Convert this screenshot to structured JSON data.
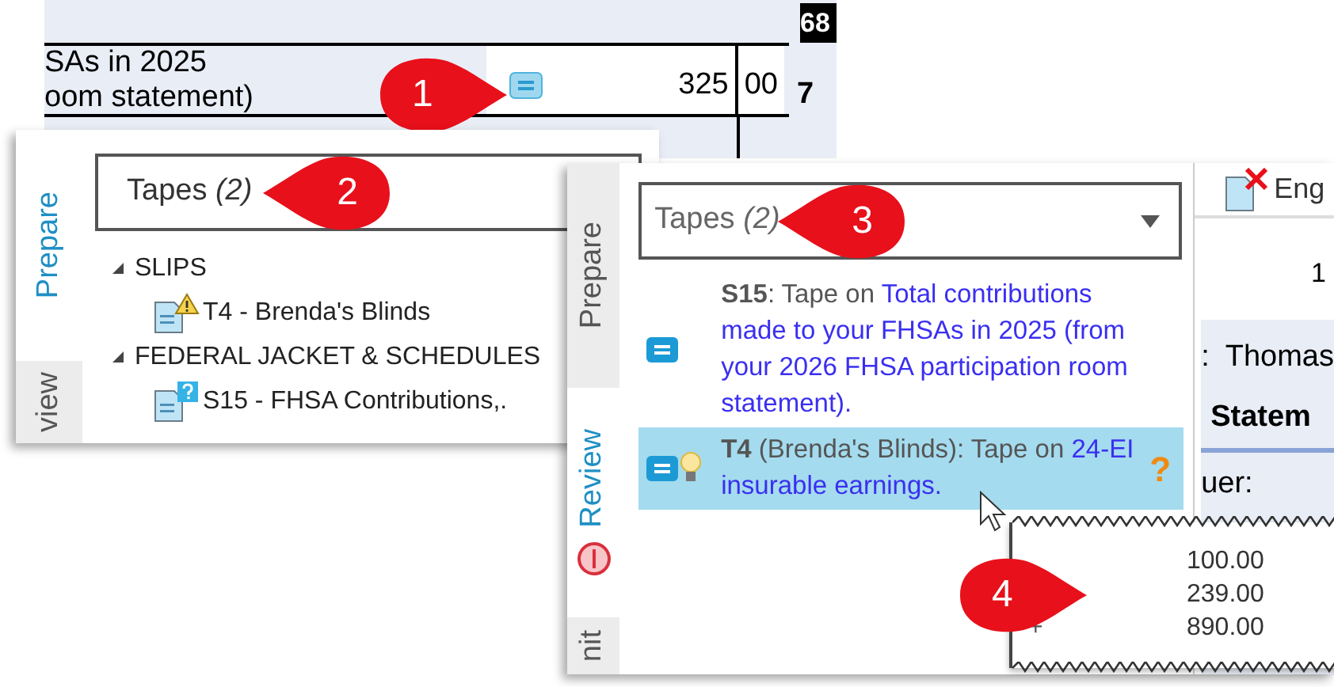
{
  "form_snippet": {
    "column_header": "68",
    "description_lines": [
      "SAs in 2025",
      "oom statement)"
    ],
    "amount_dollars": "325",
    "amount_cents": "00",
    "line_number": "7"
  },
  "left_panel": {
    "tabs": [
      {
        "label": "Prepare",
        "selected": true
      },
      {
        "label": "view",
        "selected": false
      }
    ],
    "dropdown": {
      "value": "Tapes",
      "count": "(2)"
    },
    "tree": [
      {
        "label": "SLIPS",
        "expanded": true,
        "children": [
          {
            "label": "T4 - Brenda's Blinds",
            "kind": "warning"
          }
        ]
      },
      {
        "label": "FEDERAL JACKET & SCHEDULES",
        "expanded": true,
        "children": [
          {
            "label": "S15 - FHSA Contributions,.",
            "kind": "question"
          }
        ]
      }
    ]
  },
  "right_panel": {
    "tabs": [
      {
        "label": "Prepare",
        "selected": false
      },
      {
        "label": "Review",
        "selected": true
      },
      {
        "label": "nit",
        "selected": false
      }
    ],
    "dropdown": {
      "value": "Tapes",
      "count": "(2)"
    },
    "tapes": [
      {
        "form": "S15",
        "note": ": Tape on ",
        "link": "Total contributions made to your FHSAs in 2025 (from your 2026 FHSA participation room statement).",
        "selected": false,
        "hint": false
      },
      {
        "form": "T4",
        "note": " (Brenda's Blinds): Tape on ",
        "link": "24-EI insurable earnings.",
        "selected": true,
        "hint": true,
        "query_mark": "?"
      }
    ]
  },
  "side_view": {
    "toolbar_label": "Eng",
    "page_number": "1",
    "label_fragment": ":",
    "name_value": "Thomas",
    "heading": "Statem",
    "field_label": "uer:"
  },
  "tape_popup": {
    "rows": [
      {
        "value": "100.00"
      },
      {
        "value": "239.00"
      },
      {
        "sign": "+",
        "value": "890.00"
      }
    ]
  },
  "callouts": [
    "1",
    "2",
    "3",
    "4"
  ]
}
